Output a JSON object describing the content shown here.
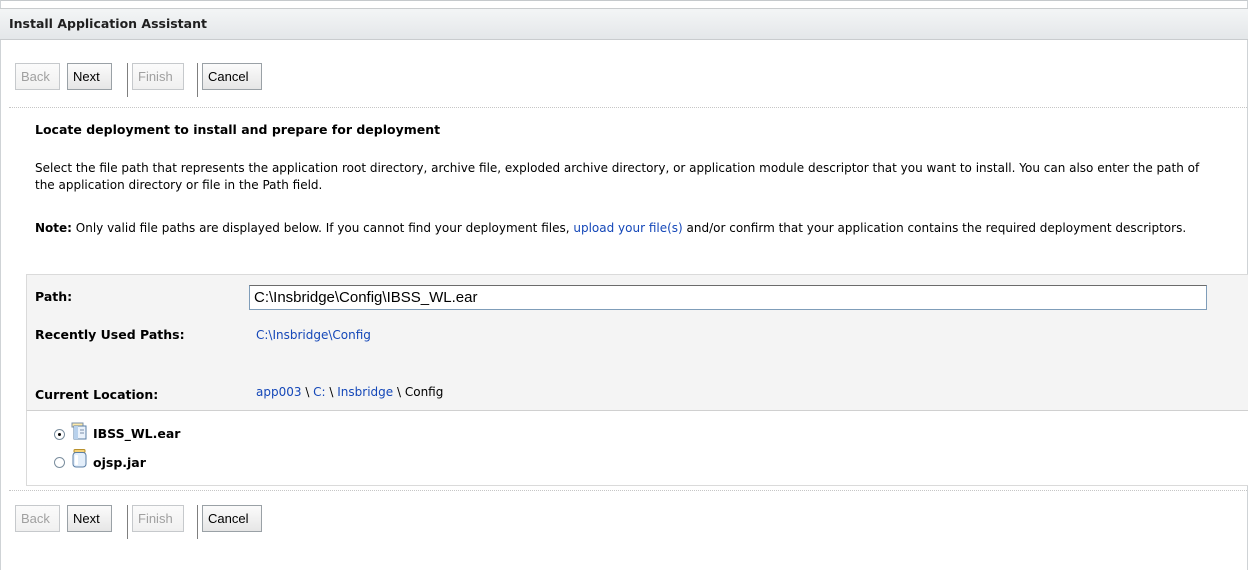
{
  "window": {
    "title": "Install Application Assistant"
  },
  "buttons": {
    "back": "Back",
    "next": "Next",
    "finish": "Finish",
    "cancel": "Cancel"
  },
  "content": {
    "heading": "Locate deployment to install and prepare for deployment",
    "description": "Select the file path that represents the application root directory, archive file, exploded archive directory, or application module descriptor that you want to install. You can also enter the path of the application directory or file in the Path field.",
    "note_label": "Note:",
    "note_text_before": " Only valid file paths are displayed below. If you cannot find your deployment files, ",
    "note_link": "upload your file(s)",
    "note_text_after": " and/or confirm that your application contains the required deployment descriptors."
  },
  "form": {
    "path_label": "Path:",
    "path_value": "C:\\Insbridge\\Config\\IBSS_WL.ear",
    "recent_label": "Recently Used Paths:",
    "recent_path": "C:\\Insbridge\\Config",
    "location_label": "Current Location:",
    "location_crumbs": [
      "app003",
      "C:",
      "Insbridge",
      "Config"
    ],
    "crumb_separator": " \\ "
  },
  "files": [
    {
      "name": "IBSS_WL.ear",
      "selected": true,
      "icon": "ear-archive-icon"
    },
    {
      "name": "ojsp.jar",
      "selected": false,
      "icon": "jar-archive-icon"
    }
  ]
}
